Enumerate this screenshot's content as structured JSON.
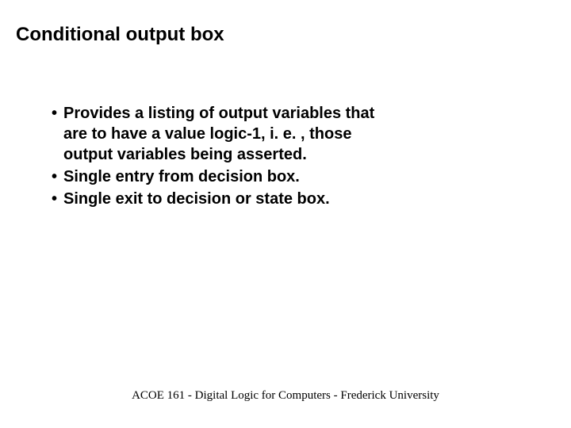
{
  "slide": {
    "title": "Conditional output box",
    "bullets": [
      "Provides a listing of output variables that are to have a value logic-1, i. e. , those output variables being asserted.",
      "Single entry from decision box.",
      "Single exit to decision or state box."
    ],
    "footer": "ACOE 161 - Digital Logic for Computers - Frederick University"
  }
}
